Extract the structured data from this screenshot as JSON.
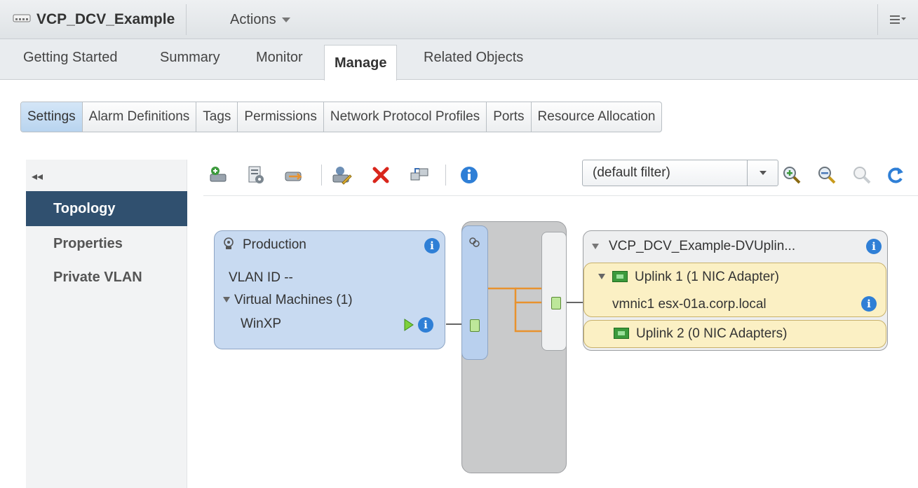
{
  "header": {
    "title": "VCP_DCV_Example",
    "actions_label": "Actions"
  },
  "main_tabs": [
    "Getting Started",
    "Summary",
    "Monitor",
    "Manage",
    "Related Objects"
  ],
  "sub_tabs": [
    "Settings",
    "Alarm Definitions",
    "Tags",
    "Permissions",
    "Network Protocol Profiles",
    "Ports",
    "Resource Allocation"
  ],
  "left_nav": {
    "collapse": "◂◂",
    "items": [
      "Topology",
      "Properties",
      "Private VLAN"
    ]
  },
  "toolbar": {
    "filter_value": "(default filter)"
  },
  "port_group": {
    "name": "Production",
    "vlan": "VLAN ID --",
    "vm_header": "Virtual Machines (1)",
    "vm_name": "WinXP"
  },
  "uplinks": {
    "name": "VCP_DCV_Example-DVUplin...",
    "uplink1": "Uplink 1 (1 NIC Adapter)",
    "uplink1_nic": "vmnic1 esx-01a.corp.local",
    "uplink2": "Uplink 2 (0 NIC Adapters)"
  },
  "colors": {
    "accent": "#30506f",
    "connection": "#e8922e",
    "info": "#2f7fd6"
  }
}
